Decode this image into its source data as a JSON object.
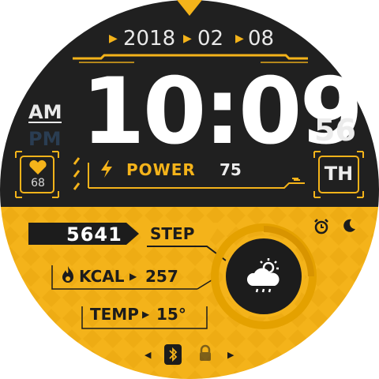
{
  "date": {
    "year": "2018",
    "month": "02",
    "day": "08"
  },
  "time": {
    "hours_minutes": "10:09",
    "seconds": "56",
    "am": "AM",
    "pm": "PM",
    "active_period": "AM"
  },
  "heart": {
    "value": "68"
  },
  "power": {
    "label": "POWER",
    "value": "75"
  },
  "weekday": {
    "label": "TH"
  },
  "steps": {
    "value": "5641",
    "label": "STEP"
  },
  "kcal": {
    "label": "KCAL",
    "value": "257"
  },
  "temp": {
    "label": "TEMP",
    "value": "15°"
  },
  "weather": {
    "icon": "cloud-sun-rain-icon"
  },
  "status_icons": [
    "alarm-icon",
    "moon-icon",
    "bluetooth-icon",
    "lock-icon"
  ],
  "colors": {
    "accent": "#f4b31a",
    "dark": "#1c1c1c",
    "background_dark": "#202020",
    "pm_inactive": "#2a3d52"
  }
}
